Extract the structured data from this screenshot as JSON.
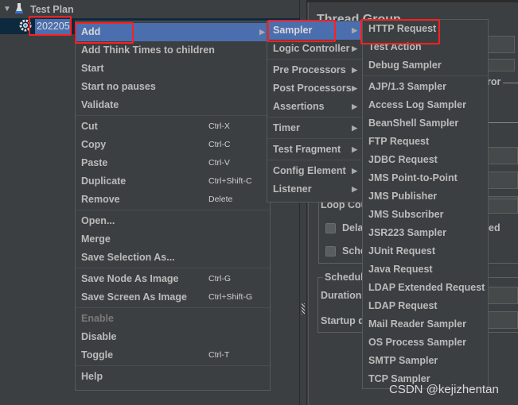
{
  "tree": {
    "root_label": "Test Plan",
    "child_label": "202205"
  },
  "right_panel": {
    "title": "Thread Group",
    "fragments": {
      "error": "ror",
      "loop": "Loop Cou",
      "delay": "Dela",
      "delay_tail": "ed",
      "scheduler": "Sche",
      "scheduler_group": "Schedule",
      "duration": "Duration",
      "startup": "Startup d"
    }
  },
  "context_menu": {
    "items": [
      {
        "label": "Add",
        "submenu": true,
        "highlighted": true
      },
      {
        "label": "Add Think Times to children"
      },
      {
        "label": "Start"
      },
      {
        "label": "Start no pauses"
      },
      {
        "label": "Validate",
        "sep_after": true
      },
      {
        "label": "Cut",
        "shortcut": "Ctrl-X"
      },
      {
        "label": "Copy",
        "shortcut": "Ctrl-C"
      },
      {
        "label": "Paste",
        "shortcut": "Ctrl-V"
      },
      {
        "label": "Duplicate",
        "shortcut": "Ctrl+Shift-C"
      },
      {
        "label": "Remove",
        "shortcut": "Delete",
        "sep_after": true
      },
      {
        "label": "Open..."
      },
      {
        "label": "Merge"
      },
      {
        "label": "Save Selection As...",
        "sep_after": true
      },
      {
        "label": "Save Node As Image",
        "shortcut": "Ctrl-G"
      },
      {
        "label": "Save Screen As Image",
        "shortcut": "Ctrl+Shift-G",
        "sep_after": true
      },
      {
        "label": "Enable",
        "disabled": true
      },
      {
        "label": "Disable"
      },
      {
        "label": "Toggle",
        "shortcut": "Ctrl-T",
        "sep_after": true
      },
      {
        "label": "Help"
      }
    ]
  },
  "add_submenu": {
    "items": [
      {
        "label": "Sampler",
        "submenu": true,
        "highlighted": true
      },
      {
        "label": "Logic Controller",
        "submenu": true,
        "sep_after": true
      },
      {
        "label": "Pre Processors",
        "submenu": true
      },
      {
        "label": "Post Processors",
        "submenu": true
      },
      {
        "label": "Assertions",
        "submenu": true,
        "sep_after": true
      },
      {
        "label": "Timer",
        "submenu": true,
        "sep_after": true
      },
      {
        "label": "Test Fragment",
        "submenu": true,
        "sep_after": true
      },
      {
        "label": "Config Element",
        "submenu": true
      },
      {
        "label": "Listener",
        "submenu": true
      }
    ]
  },
  "sampler_submenu": {
    "items": [
      {
        "label": "HTTP Request"
      },
      {
        "label": "Test Action"
      },
      {
        "label": "Debug Sampler",
        "sep_after": true
      },
      {
        "label": "AJP/1.3 Sampler"
      },
      {
        "label": "Access Log Sampler"
      },
      {
        "label": "BeanShell Sampler"
      },
      {
        "label": "FTP Request"
      },
      {
        "label": "JDBC Request"
      },
      {
        "label": "JMS Point-to-Point"
      },
      {
        "label": "JMS Publisher"
      },
      {
        "label": "JMS Subscriber"
      },
      {
        "label": "JSR223 Sampler"
      },
      {
        "label": "JUnit Request"
      },
      {
        "label": "Java Request"
      },
      {
        "label": "LDAP Extended Request"
      },
      {
        "label": "LDAP Request"
      },
      {
        "label": "Mail Reader Sampler"
      },
      {
        "label": "OS Process Sampler"
      },
      {
        "label": "SMTP Sampler"
      },
      {
        "label": "TCP Sampler"
      }
    ]
  },
  "watermark": "CSDN @kejizhentan",
  "colors": {
    "background": "#3c3f41",
    "highlight": "#4b6eaf",
    "annotation_box": "#ff2020",
    "text": "#bbbbbb"
  }
}
